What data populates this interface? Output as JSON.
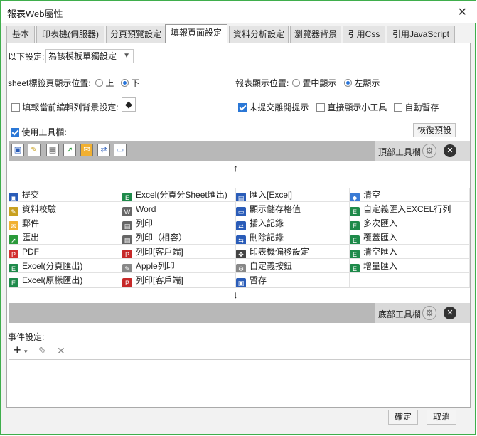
{
  "window": {
    "title": "報表Web屬性",
    "close_glyph": "✕"
  },
  "tabs": [
    {
      "label": "基本"
    },
    {
      "label": "印表機(伺服器)"
    },
    {
      "label": "分頁預覽設定"
    },
    {
      "label": "填報頁面設定"
    },
    {
      "label": "資料分析設定"
    },
    {
      "label": "瀏覽器背景"
    },
    {
      "label": "引用Css"
    },
    {
      "label": "引用JavaScript"
    }
  ],
  "settings": {
    "scope_label": "以下設定:",
    "scope_value": "為該模板單獨設定",
    "sheet_pos_label": "sheet標籤頁顯示位置:",
    "sheet_pos_top": "上",
    "sheet_pos_bottom": "下",
    "report_pos_label": "報表顯示位置:",
    "report_pos_center": "置中顯示",
    "report_pos_left": "左顯示",
    "fill_bg_label": "填報當前編輯列背景設定:",
    "unsubmitted_label": "未提交離開提示",
    "show_tools_label": "直接顯示小工具",
    "autosave_label": "自動暫存",
    "use_toolbar_label": "使用工具欄:",
    "restore_label": "恢復預設"
  },
  "top_toolbar": {
    "label": "頂部工具欄"
  },
  "bottom_toolbar": {
    "label": "底部工具欄"
  },
  "arrows": {
    "up": "↑",
    "down": "↓"
  },
  "items": [
    [
      "提交",
      "Excel(分頁分Sheet匯出)",
      "匯入[Excel]",
      "清空"
    ],
    [
      "資料校驗",
      "Word",
      "顯示儲存格值",
      "自定義匯入EXCEL行列"
    ],
    [
      "郵件",
      "列印",
      "插入記錄",
      "多次匯入"
    ],
    [
      "匯出",
      "列印（相容）",
      "刪除記錄",
      "覆蓋匯入"
    ],
    [
      "PDF",
      "列印[客戶端]",
      "印表機偏移設定",
      "清空匯入"
    ],
    [
      "Excel(分頁匯出)",
      "Apple列印",
      "自定義按鈕",
      "增量匯入"
    ],
    [
      "Excel(原樣匯出)",
      "列印[客戶端]",
      "暫存",
      ""
    ]
  ],
  "events": {
    "label": "事件設定:",
    "add_glyph": "+",
    "dropdown_glyph": "▾",
    "edit_glyph": "✎",
    "delete_glyph": "✕"
  },
  "footer": {
    "ok_label": "確定",
    "cancel_label": "取消"
  }
}
